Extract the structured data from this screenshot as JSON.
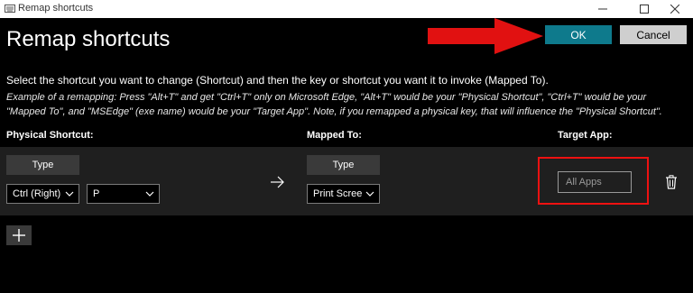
{
  "window": {
    "title": "Remap shortcuts",
    "icon": "keyboard-icon",
    "controls": [
      "minimize-icon",
      "maximize-icon",
      "close-icon"
    ]
  },
  "header": {
    "title": "Remap shortcuts",
    "ok_label": "OK",
    "cancel_label": "Cancel"
  },
  "instruction": "Select the shortcut you want to change (Shortcut) and then the key or shortcut you want it to invoke (Mapped To).",
  "example": "Example of a remapping: Press \"Alt+T\" and get \"Ctrl+T\" only on Microsoft Edge, \"Alt+T\" would be your \"Physical Shortcut\", \"Ctrl+T\" would be your \"Mapped To\", and \"MSEdge\" (exe name) would be your \"Target App\". Note, if you remapped a physical key, that will influence the \"Physical Shortcut\".",
  "columns": {
    "physical": "Physical Shortcut:",
    "mapped": "Mapped To:",
    "target": "Target App:"
  },
  "row": {
    "physical_type_label": "Type",
    "physical_keys": [
      "Ctrl (Right)",
      "P"
    ],
    "mapped_type_label": "Type",
    "mapped_key": "Print Scree",
    "target_placeholder": "All Apps"
  },
  "colors": {
    "accent": "#0e7a8c",
    "annotation": "#e11111",
    "row_background": "#1f1f1f"
  }
}
